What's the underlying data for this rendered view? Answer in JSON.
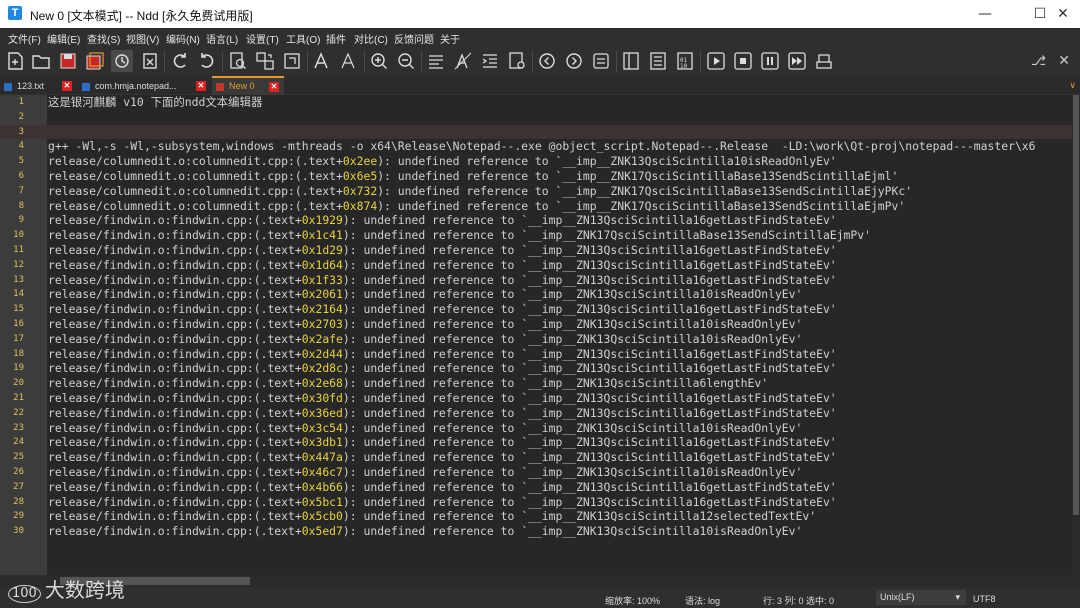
{
  "window": {
    "title": "New 0 [文本模式] -- Ndd [永久免费试用版]",
    "app_icon": "T"
  },
  "menu": [
    "文件(F)",
    "编辑(E)",
    "查找(S)",
    "视图(V)",
    "编码(N)",
    "语言(L)",
    "设置(T)",
    "工具(O)",
    "插件",
    "对比(C)",
    "反馈问题",
    "关于"
  ],
  "tabs": [
    {
      "label": "123.txt",
      "active": false
    },
    {
      "label": "com.hmja.notepad...",
      "active": false
    },
    {
      "label": "New 0",
      "active": true
    }
  ],
  "editor": {
    "lines": [
      {
        "n": "1",
        "pre": "这是银河麒麟 v10 下面的ndd文本编辑器",
        "hex": "",
        "post": ""
      },
      {
        "n": "2",
        "pre": "",
        "hex": "",
        "post": ""
      },
      {
        "n": "3",
        "pre": "",
        "hex": "",
        "post": ""
      },
      {
        "n": "4",
        "pre": "g++ -Wl,-s -Wl,-subsystem,windows -mthreads -o x64\\Release\\Notepad--.exe @object_script.Notepad--.Release  -LD:\\work\\Qt-proj\\notepad---master\\x6",
        "hex": "",
        "post": ""
      },
      {
        "n": "5",
        "pre": "release/columnedit.o:columnedit.cpp:(.text+",
        "hex": "0x2ee",
        "post": "): undefined reference to `__imp__ZNK13QsciScintilla10isReadOnlyEv'"
      },
      {
        "n": "6",
        "pre": "release/columnedit.o:columnedit.cpp:(.text+",
        "hex": "0x6e5",
        "post": "): undefined reference to `__imp__ZNK17QsciScintillaBase13SendScintillaEjml'"
      },
      {
        "n": "7",
        "pre": "release/columnedit.o:columnedit.cpp:(.text+",
        "hex": "0x732",
        "post": "): undefined reference to `__imp__ZNK17QsciScintillaBase13SendScintillaEjyPKc'"
      },
      {
        "n": "8",
        "pre": "release/columnedit.o:columnedit.cpp:(.text+",
        "hex": "0x874",
        "post": "): undefined reference to `__imp__ZNK17QsciScintillaBase13SendScintillaEjmPv'"
      },
      {
        "n": "9",
        "pre": "release/findwin.o:findwin.cpp:(.text+",
        "hex": "0x1929",
        "post": "): undefined reference to `__imp__ZN13QsciScintilla16getLastFindStateEv'"
      },
      {
        "n": "10",
        "pre": "release/findwin.o:findwin.cpp:(.text+",
        "hex": "0x1c41",
        "post": "): undefined reference to `__imp__ZNK17QsciScintillaBase13SendScintillaEjmPv'"
      },
      {
        "n": "11",
        "pre": "release/findwin.o:findwin.cpp:(.text+",
        "hex": "0x1d29",
        "post": "): undefined reference to `__imp__ZN13QsciScintilla16getLastFindStateEv'"
      },
      {
        "n": "12",
        "pre": "release/findwin.o:findwin.cpp:(.text+",
        "hex": "0x1d64",
        "post": "): undefined reference to `__imp__ZN13QsciScintilla16getLastFindStateEv'"
      },
      {
        "n": "13",
        "pre": "release/findwin.o:findwin.cpp:(.text+",
        "hex": "0x1f33",
        "post": "): undefined reference to `__imp__ZN13QsciScintilla16getLastFindStateEv'"
      },
      {
        "n": "14",
        "pre": "release/findwin.o:findwin.cpp:(.text+",
        "hex": "0x2061",
        "post": "): undefined reference to `__imp__ZNK13QsciScintilla10isReadOnlyEv'"
      },
      {
        "n": "15",
        "pre": "release/findwin.o:findwin.cpp:(.text+",
        "hex": "0x2164",
        "post": "): undefined reference to `__imp__ZN13QsciScintilla16getLastFindStateEv'"
      },
      {
        "n": "16",
        "pre": "release/findwin.o:findwin.cpp:(.text+",
        "hex": "0x2703",
        "post": "): undefined reference to `__imp__ZNK13QsciScintilla10isReadOnlyEv'"
      },
      {
        "n": "17",
        "pre": "release/findwin.o:findwin.cpp:(.text+",
        "hex": "0x2afe",
        "post": "): undefined reference to `__imp__ZNK13QsciScintilla10isReadOnlyEv'"
      },
      {
        "n": "18",
        "pre": "release/findwin.o:findwin.cpp:(.text+",
        "hex": "0x2d44",
        "post": "): undefined reference to `__imp__ZN13QsciScintilla16getLastFindStateEv'"
      },
      {
        "n": "19",
        "pre": "release/findwin.o:findwin.cpp:(.text+",
        "hex": "0x2d8c",
        "post": "): undefined reference to `__imp__ZN13QsciScintilla16getLastFindStateEv'"
      },
      {
        "n": "20",
        "pre": "release/findwin.o:findwin.cpp:(.text+",
        "hex": "0x2e68",
        "post": "): undefined reference to `__imp__ZNK13QsciScintilla6lengthEv'"
      },
      {
        "n": "21",
        "pre": "release/findwin.o:findwin.cpp:(.text+",
        "hex": "0x30fd",
        "post": "): undefined reference to `__imp__ZN13QsciScintilla16getLastFindStateEv'"
      },
      {
        "n": "22",
        "pre": "release/findwin.o:findwin.cpp:(.text+",
        "hex": "0x36ed",
        "post": "): undefined reference to `__imp__ZN13QsciScintilla16getLastFindStateEv'"
      },
      {
        "n": "23",
        "pre": "release/findwin.o:findwin.cpp:(.text+",
        "hex": "0x3c54",
        "post": "): undefined reference to `__imp__ZNK13QsciScintilla10isReadOnlyEv'"
      },
      {
        "n": "24",
        "pre": "release/findwin.o:findwin.cpp:(.text+",
        "hex": "0x3db1",
        "post": "): undefined reference to `__imp__ZN13QsciScintilla16getLastFindStateEv'"
      },
      {
        "n": "25",
        "pre": "release/findwin.o:findwin.cpp:(.text+",
        "hex": "0x447a",
        "post": "): undefined reference to `__imp__ZN13QsciScintilla16getLastFindStateEv'"
      },
      {
        "n": "26",
        "pre": "release/findwin.o:findwin.cpp:(.text+",
        "hex": "0x46c7",
        "post": "): undefined reference to `__imp__ZNK13QsciScintilla10isReadOnlyEv'"
      },
      {
        "n": "27",
        "pre": "release/findwin.o:findwin.cpp:(.text+",
        "hex": "0x4b66",
        "post": "): undefined reference to `__imp__ZN13QsciScintilla16getLastFindStateEv'"
      },
      {
        "n": "28",
        "pre": "release/findwin.o:findwin.cpp:(.text+",
        "hex": "0x5bc1",
        "post": "): undefined reference to `__imp__ZN13QsciScintilla16getLastFindStateEv'"
      },
      {
        "n": "29",
        "pre": "release/findwin.o:findwin.cpp:(.text+",
        "hex": "0x5cb0",
        "post": "): undefined reference to `__imp__ZNK13QsciScintilla12selectedTextEv'"
      },
      {
        "n": "30",
        "pre": "release/findwin.o:findwin.cpp:(.text+",
        "hex": "0x5ed7",
        "post": "): undefined reference to `__imp__ZNK13QsciScintilla10isReadOnlyEv'"
      }
    ],
    "current_line": "3"
  },
  "status": {
    "zoom": "缩放率: 100%",
    "lang": "语法:  log",
    "position": "行: 3 列: 0 选中: 0",
    "eol": "Unix(LF)",
    "encoding": "UTF8"
  },
  "watermark": "大数跨境",
  "colors": {
    "background": "#272727",
    "gutter": "#3c3c3c",
    "line_number": "#e0c060",
    "hex_number": "#e8d33a",
    "text": "#d0d0d0",
    "active_tab": "#e69b2d"
  },
  "toolbar_icons": [
    "new-file-icon",
    "open-file-icon",
    "save-icon",
    "save-all-icon",
    "close-file-icon",
    "close-all-icon",
    "undo-icon",
    "redo-icon",
    "find-icon",
    "replace-icon",
    "bold-a-icon",
    "font-a-icon",
    "zoom-in-icon",
    "zoom-out-icon",
    "wrap-icon",
    "format-icon",
    "indent-icon",
    "preview-icon",
    "prev-icon",
    "next-icon",
    "doc-icon",
    "compare-icon",
    "list-icon",
    "binary-icon",
    "play-icon",
    "stop-icon",
    "pause-icon",
    "fast-forward-icon",
    "macro-icon"
  ]
}
